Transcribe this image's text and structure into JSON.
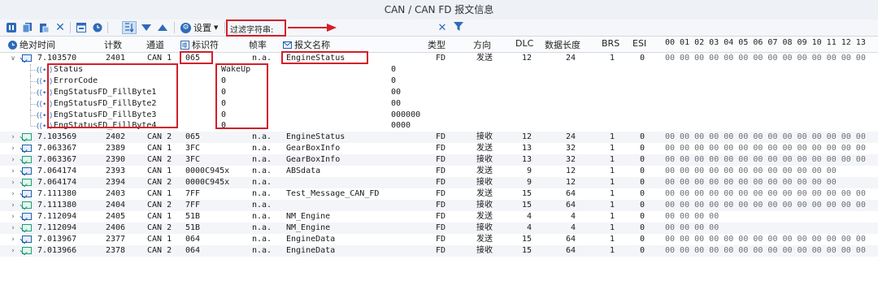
{
  "window": {
    "title": "CAN / CAN FD 报文信息"
  },
  "toolbar": {
    "settings_label": "设置",
    "filter_label": "过滤字符串:",
    "filter_value": ""
  },
  "columns": {
    "time": "绝对时间",
    "count": "计数",
    "channel": "通道",
    "id": "标识符",
    "rate": "帧率",
    "name": "报文名称",
    "type": "类型",
    "dir": "方向",
    "dlc": "DLC",
    "length": "数据长度",
    "brs": "BRS",
    "esi": "ESI",
    "bytes": "00 01 02 03 04 05 06 07 08 09 10 11 12 13"
  },
  "expanded": {
    "time": "7.103570",
    "count": "2401",
    "channel": "CAN 1",
    "id": "065",
    "rate": "n.a.",
    "name": "EngineStatus",
    "type": "FD",
    "dir": "发送",
    "dlc": "12",
    "length": "24",
    "brs": "1",
    "esi": "0",
    "bytes": "00 00 00 00 00 00 00 00 00 00 00 00 00 00"
  },
  "signals": [
    {
      "name": "Status",
      "value": "WakeUp",
      "raw": "0"
    },
    {
      "name": "ErrorCode",
      "value": "0",
      "raw": "0"
    },
    {
      "name": "EngStatusFD_FillByte1",
      "value": "0",
      "raw": "00"
    },
    {
      "name": "EngStatusFD_FillByte2",
      "value": "0",
      "raw": "00"
    },
    {
      "name": "EngStatusFD_FillByte3",
      "value": "0",
      "raw": "000000"
    },
    {
      "name": "EngStatusFD_FillByte4",
      "value": "0",
      "raw": "0000"
    }
  ],
  "rows": [
    {
      "time": "7.103569",
      "count": "2402",
      "channel": "CAN 2",
      "id": "065",
      "rate": "n.a.",
      "name": "EngineStatus",
      "type": "FD",
      "dir": "接收",
      "dlc": "12",
      "length": "24",
      "brs": "1",
      "esi": "0",
      "bytes": "00 00 00 00 00 00 00 00 00 00 00 00 00 00",
      "kind": "rx"
    },
    {
      "time": "7.063367",
      "count": "2389",
      "channel": "CAN 1",
      "id": "3FC",
      "rate": "n.a.",
      "name": "GearBoxInfo",
      "type": "FD",
      "dir": "发送",
      "dlc": "13",
      "length": "32",
      "brs": "1",
      "esi": "0",
      "bytes": "00 00 00 00 00 00 00 00 00 00 00 00 00 00",
      "kind": "tx"
    },
    {
      "time": "7.063367",
      "count": "2390",
      "channel": "CAN 2",
      "id": "3FC",
      "rate": "n.a.",
      "name": "GearBoxInfo",
      "type": "FD",
      "dir": "接收",
      "dlc": "13",
      "length": "32",
      "brs": "1",
      "esi": "0",
      "bytes": "00 00 00 00 00 00 00 00 00 00 00 00 00 00",
      "kind": "rx"
    },
    {
      "time": "7.064174",
      "count": "2393",
      "channel": "CAN 1",
      "id": "0000C945x",
      "rate": "n.a.",
      "name": "ABSdata",
      "type": "FD",
      "dir": "发送",
      "dlc": "9",
      "length": "12",
      "brs": "1",
      "esi": "0",
      "bytes": "00 00 00 00 00 00 00 00 00 00 00 00",
      "kind": "tx"
    },
    {
      "time": "7.064174",
      "count": "2394",
      "channel": "CAN 2",
      "id": "0000C945x",
      "rate": "n.a.",
      "name": "",
      "type": "FD",
      "dir": "接收",
      "dlc": "9",
      "length": "12",
      "brs": "1",
      "esi": "0",
      "bytes": "00 00 00 00 00 00 00 00 00 00 00 00",
      "kind": "rx"
    },
    {
      "time": "7.111380",
      "count": "2403",
      "channel": "CAN 1",
      "id": "7FF",
      "rate": "n.a.",
      "name": "Test_Message_CAN_FD",
      "type": "FD",
      "dir": "发送",
      "dlc": "15",
      "length": "64",
      "brs": "1",
      "esi": "0",
      "bytes": "00 00 00 00 00 00 00 00 00 00 00 00 00 00",
      "kind": "tx"
    },
    {
      "time": "7.111380",
      "count": "2404",
      "channel": "CAN 2",
      "id": "7FF",
      "rate": "n.a.",
      "name": "",
      "type": "FD",
      "dir": "接收",
      "dlc": "15",
      "length": "64",
      "brs": "1",
      "esi": "0",
      "bytes": "00 00 00 00 00 00 00 00 00 00 00 00 00 00",
      "kind": "rx"
    },
    {
      "time": "7.112094",
      "count": "2405",
      "channel": "CAN 1",
      "id": "51B",
      "rate": "n.a.",
      "name": "NM_Engine",
      "type": "FD",
      "dir": "发送",
      "dlc": "4",
      "length": "4",
      "brs": "1",
      "esi": "0",
      "bytes": "00 00 00 00",
      "kind": "tx"
    },
    {
      "time": "7.112094",
      "count": "2406",
      "channel": "CAN 2",
      "id": "51B",
      "rate": "n.a.",
      "name": "NM_Engine",
      "type": "FD",
      "dir": "接收",
      "dlc": "4",
      "length": "4",
      "brs": "1",
      "esi": "0",
      "bytes": "00 00 00 00",
      "kind": "rx"
    },
    {
      "time": "7.013967",
      "count": "2377",
      "channel": "CAN 1",
      "id": "064",
      "rate": "n.a.",
      "name": "EngineData",
      "type": "FD",
      "dir": "发送",
      "dlc": "15",
      "length": "64",
      "brs": "1",
      "esi": "0",
      "bytes": "00 00 00 00 00 00 00 00 00 00 00 00 00 00",
      "kind": "tx"
    },
    {
      "time": "7.013966",
      "count": "2378",
      "channel": "CAN 2",
      "id": "064",
      "rate": "n.a.",
      "name": "EngineData",
      "type": "FD",
      "dir": "接收",
      "dlc": "15",
      "length": "64",
      "brs": "1",
      "esi": "0",
      "bytes": "00 00 00 00 00 00 00 00 00 00 00 00 00 00",
      "kind": "rx"
    }
  ]
}
